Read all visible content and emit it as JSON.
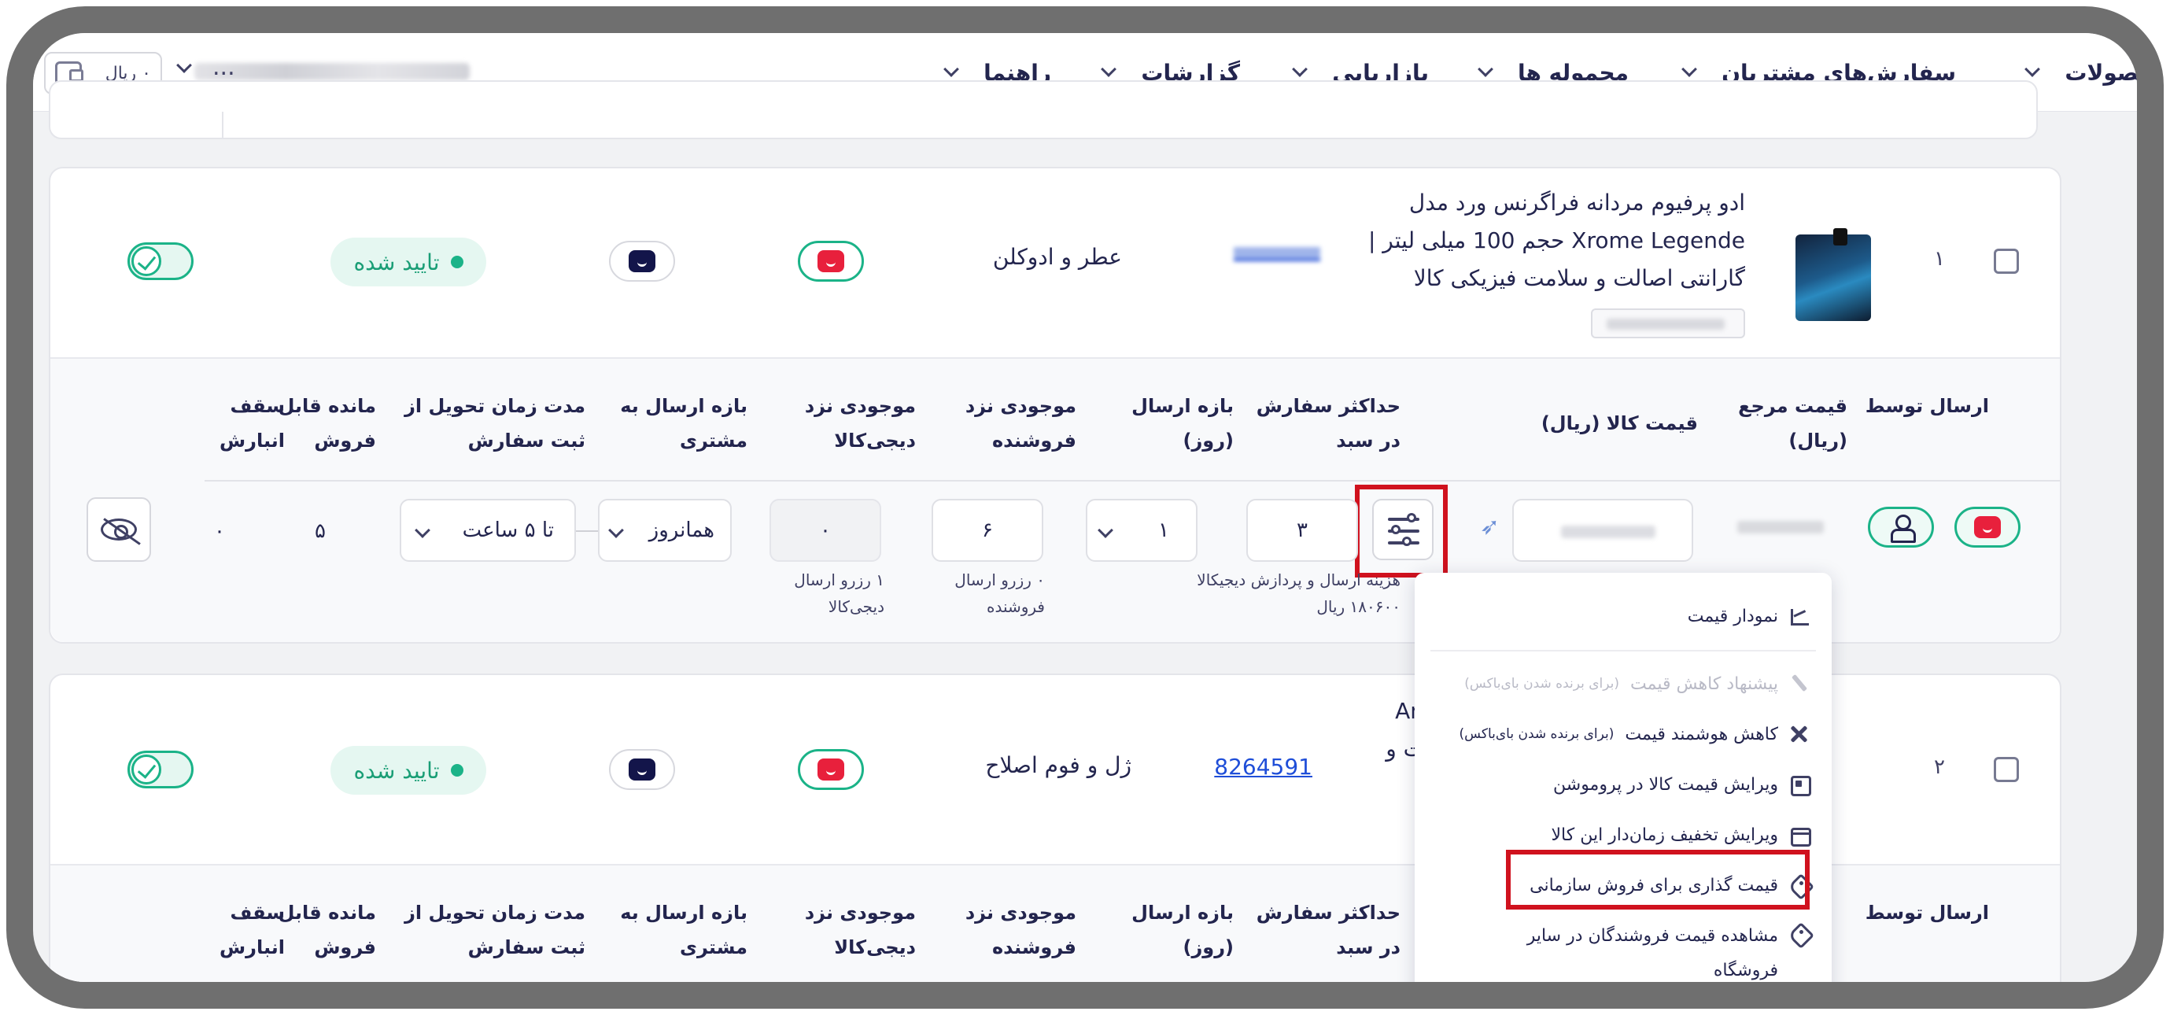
{
  "nav": {
    "items": [
      {
        "label": "محصولات"
      },
      {
        "label": "سفارش‌های مشتریان"
      },
      {
        "label": "محموله ها"
      },
      {
        "label": "بازاریابی"
      },
      {
        "label": "گزارشات"
      },
      {
        "label": "راهنما"
      }
    ],
    "wallet": "۰ ریال",
    "store_dots": "..."
  },
  "columns": {
    "ship_by": "ارسال توسط",
    "ref_price": "قیمت مرجع\n(ریال)",
    "item_price": "قیمت کالا (ریال)",
    "max_order": "حداکثر سفارش\nدر سبد",
    "ship_range": "بازه ارسال\n(روز)",
    "stock_seller": "موجودی نزد\nفروشنده",
    "stock_dk": "موجودی نزد\nدیجی‌کالا",
    "ship_to_customer": "بازه ارسال به\nمشتری",
    "delivery_time": "مدت زمان تحویل از\nثبت سفارش",
    "remaining": "مانده قابل\nفروش",
    "warehouse_cap": "سقف\nانبارش"
  },
  "rows": [
    {
      "index": "۱",
      "title_line1": "ادو پرفیوم مردانه فراگرنس ورد مدل",
      "title_line2": "Xrome Legende حجم 100 میلی لیتر |",
      "title_line3": "گارانتی اصالت و سلامت فیزیکی کالا",
      "category": "عطر و ادوکلن",
      "status": "تایید شده",
      "max_order": "۳",
      "ship_range": "۱",
      "stock_seller": "۶",
      "stock_dk": "۰",
      "ship_to_customer": "همانروز",
      "delivery_time": "تا ۵ ساعت",
      "remaining": "۵",
      "warehouse_cap": "۰",
      "note_cost": "هزینه ارسال و پردازش دیجیکالا\n۱۸۰۶۰۰ ریال",
      "note_seller": "۰ رزرو ارسال\nفروشنده",
      "note_dk": "۱ رزرو ارسال\nدیجی‌کالا"
    },
    {
      "index": "۲",
      "title_fragment1": "An",
      "title_fragment2": "ت و",
      "product_id": "8264591",
      "category": "ژل و فوم اصلاح",
      "status": "تایید شده"
    }
  ],
  "price_menu": {
    "items": [
      {
        "label": "نمودار قیمت",
        "icon": "chart-icon",
        "disabled": false
      },
      {
        "label": "پیشنهاد کاهش قیمت",
        "small": "(برای برنده شدن بای‌باکس)",
        "icon": "pen-icon",
        "disabled": true
      },
      {
        "label": "کاهش هوشمند قیمت",
        "small": "(برای برنده شدن بای‌باکس)",
        "icon": "scissors-icon",
        "disabled": false
      },
      {
        "label": "ویرایش قیمت کالا در پروموشن",
        "icon": "promo-icon",
        "disabled": false
      },
      {
        "label": "ویرایش تخفیف زمان‌دار این کالا",
        "icon": "calendar-icon",
        "disabled": false
      },
      {
        "label": "قیمت گذاری برای فروش سازمانی",
        "icon": "tag-icon",
        "disabled": false
      },
      {
        "label": "مشاهده قیمت فروشندگان در سایر فروشگاه",
        "label2": "ها",
        "icon": "tag-icon",
        "disabled": false
      }
    ]
  },
  "colors": {
    "accent_green": "#1bb388",
    "brand_red": "#e8203c",
    "link_blue": "#1f4ed8",
    "highlight_red": "#d0121e"
  }
}
